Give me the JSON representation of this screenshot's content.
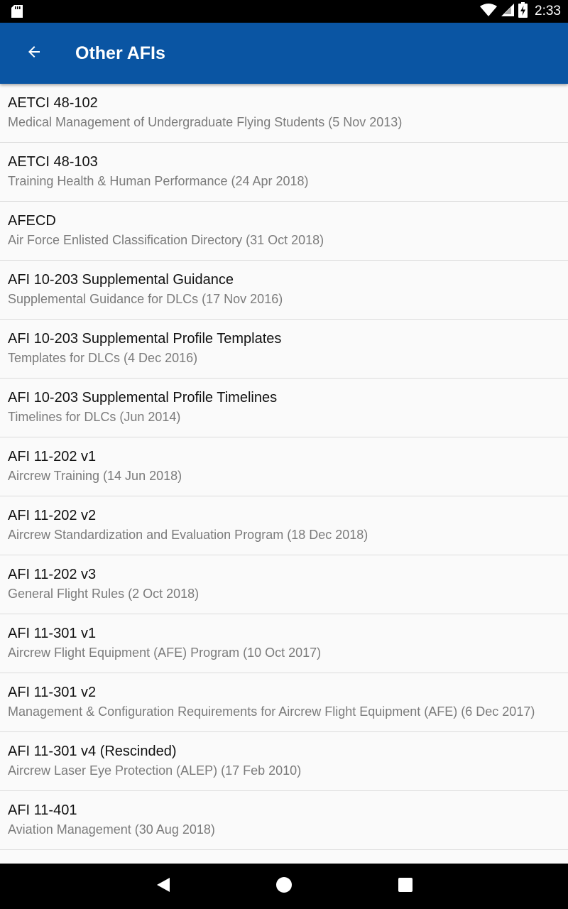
{
  "status_bar": {
    "time": "2:33",
    "icons": [
      "sd-card-icon",
      "wifi-icon",
      "signal-icon",
      "battery-charging-icon"
    ]
  },
  "app_bar": {
    "back_icon": "arrow-back-icon",
    "title": "Other AFIs",
    "color": "#0a55a3"
  },
  "items": [
    {
      "title": "AETCI 48-102",
      "subtitle": "Medical Management of Undergraduate Flying Students (5 Nov 2013)"
    },
    {
      "title": "AETCI 48-103",
      "subtitle": "Training Health & Human Performance (24 Apr 2018)"
    },
    {
      "title": "AFECD",
      "subtitle": "Air Force Enlisted Classification Directory (31 Oct 2018)"
    },
    {
      "title": "AFI 10-203 Supplemental Guidance",
      "subtitle": "Supplemental Guidance for DLCs (17 Nov 2016)"
    },
    {
      "title": "AFI 10-203 Supplemental Profile Templates",
      "subtitle": "Templates for DLCs (4 Dec 2016)"
    },
    {
      "title": "AFI 10-203 Supplemental Profile Timelines",
      "subtitle": "Timelines for DLCs (Jun 2014)"
    },
    {
      "title": "AFI 11-202 v1",
      "subtitle": "Aircrew Training (14 Jun 2018)"
    },
    {
      "title": "AFI 11-202 v2",
      "subtitle": "Aircrew Standardization and Evaluation Program (18 Dec 2018)"
    },
    {
      "title": "AFI 11-202 v3",
      "subtitle": "General Flight Rules (2 Oct 2018)"
    },
    {
      "title": "AFI 11-301 v1",
      "subtitle": "Aircrew Flight Equipment (AFE) Program (10 Oct 2017)"
    },
    {
      "title": "AFI 11-301 v2",
      "subtitle": "Management & Configuration Requirements for Aircrew Flight Equipment (AFE) (6 Dec 2017)"
    },
    {
      "title": "AFI 11-301 v4 (Rescinded)",
      "subtitle": "Aircrew Laser Eye Protection (ALEP) (17 Feb 2010)"
    },
    {
      "title": "AFI 11-401",
      "subtitle": "Aviation Management (30 Aug 2018)"
    }
  ],
  "nav_bar": {
    "buttons": [
      "back-triangle-icon",
      "home-circle-icon",
      "recents-square-icon"
    ]
  }
}
